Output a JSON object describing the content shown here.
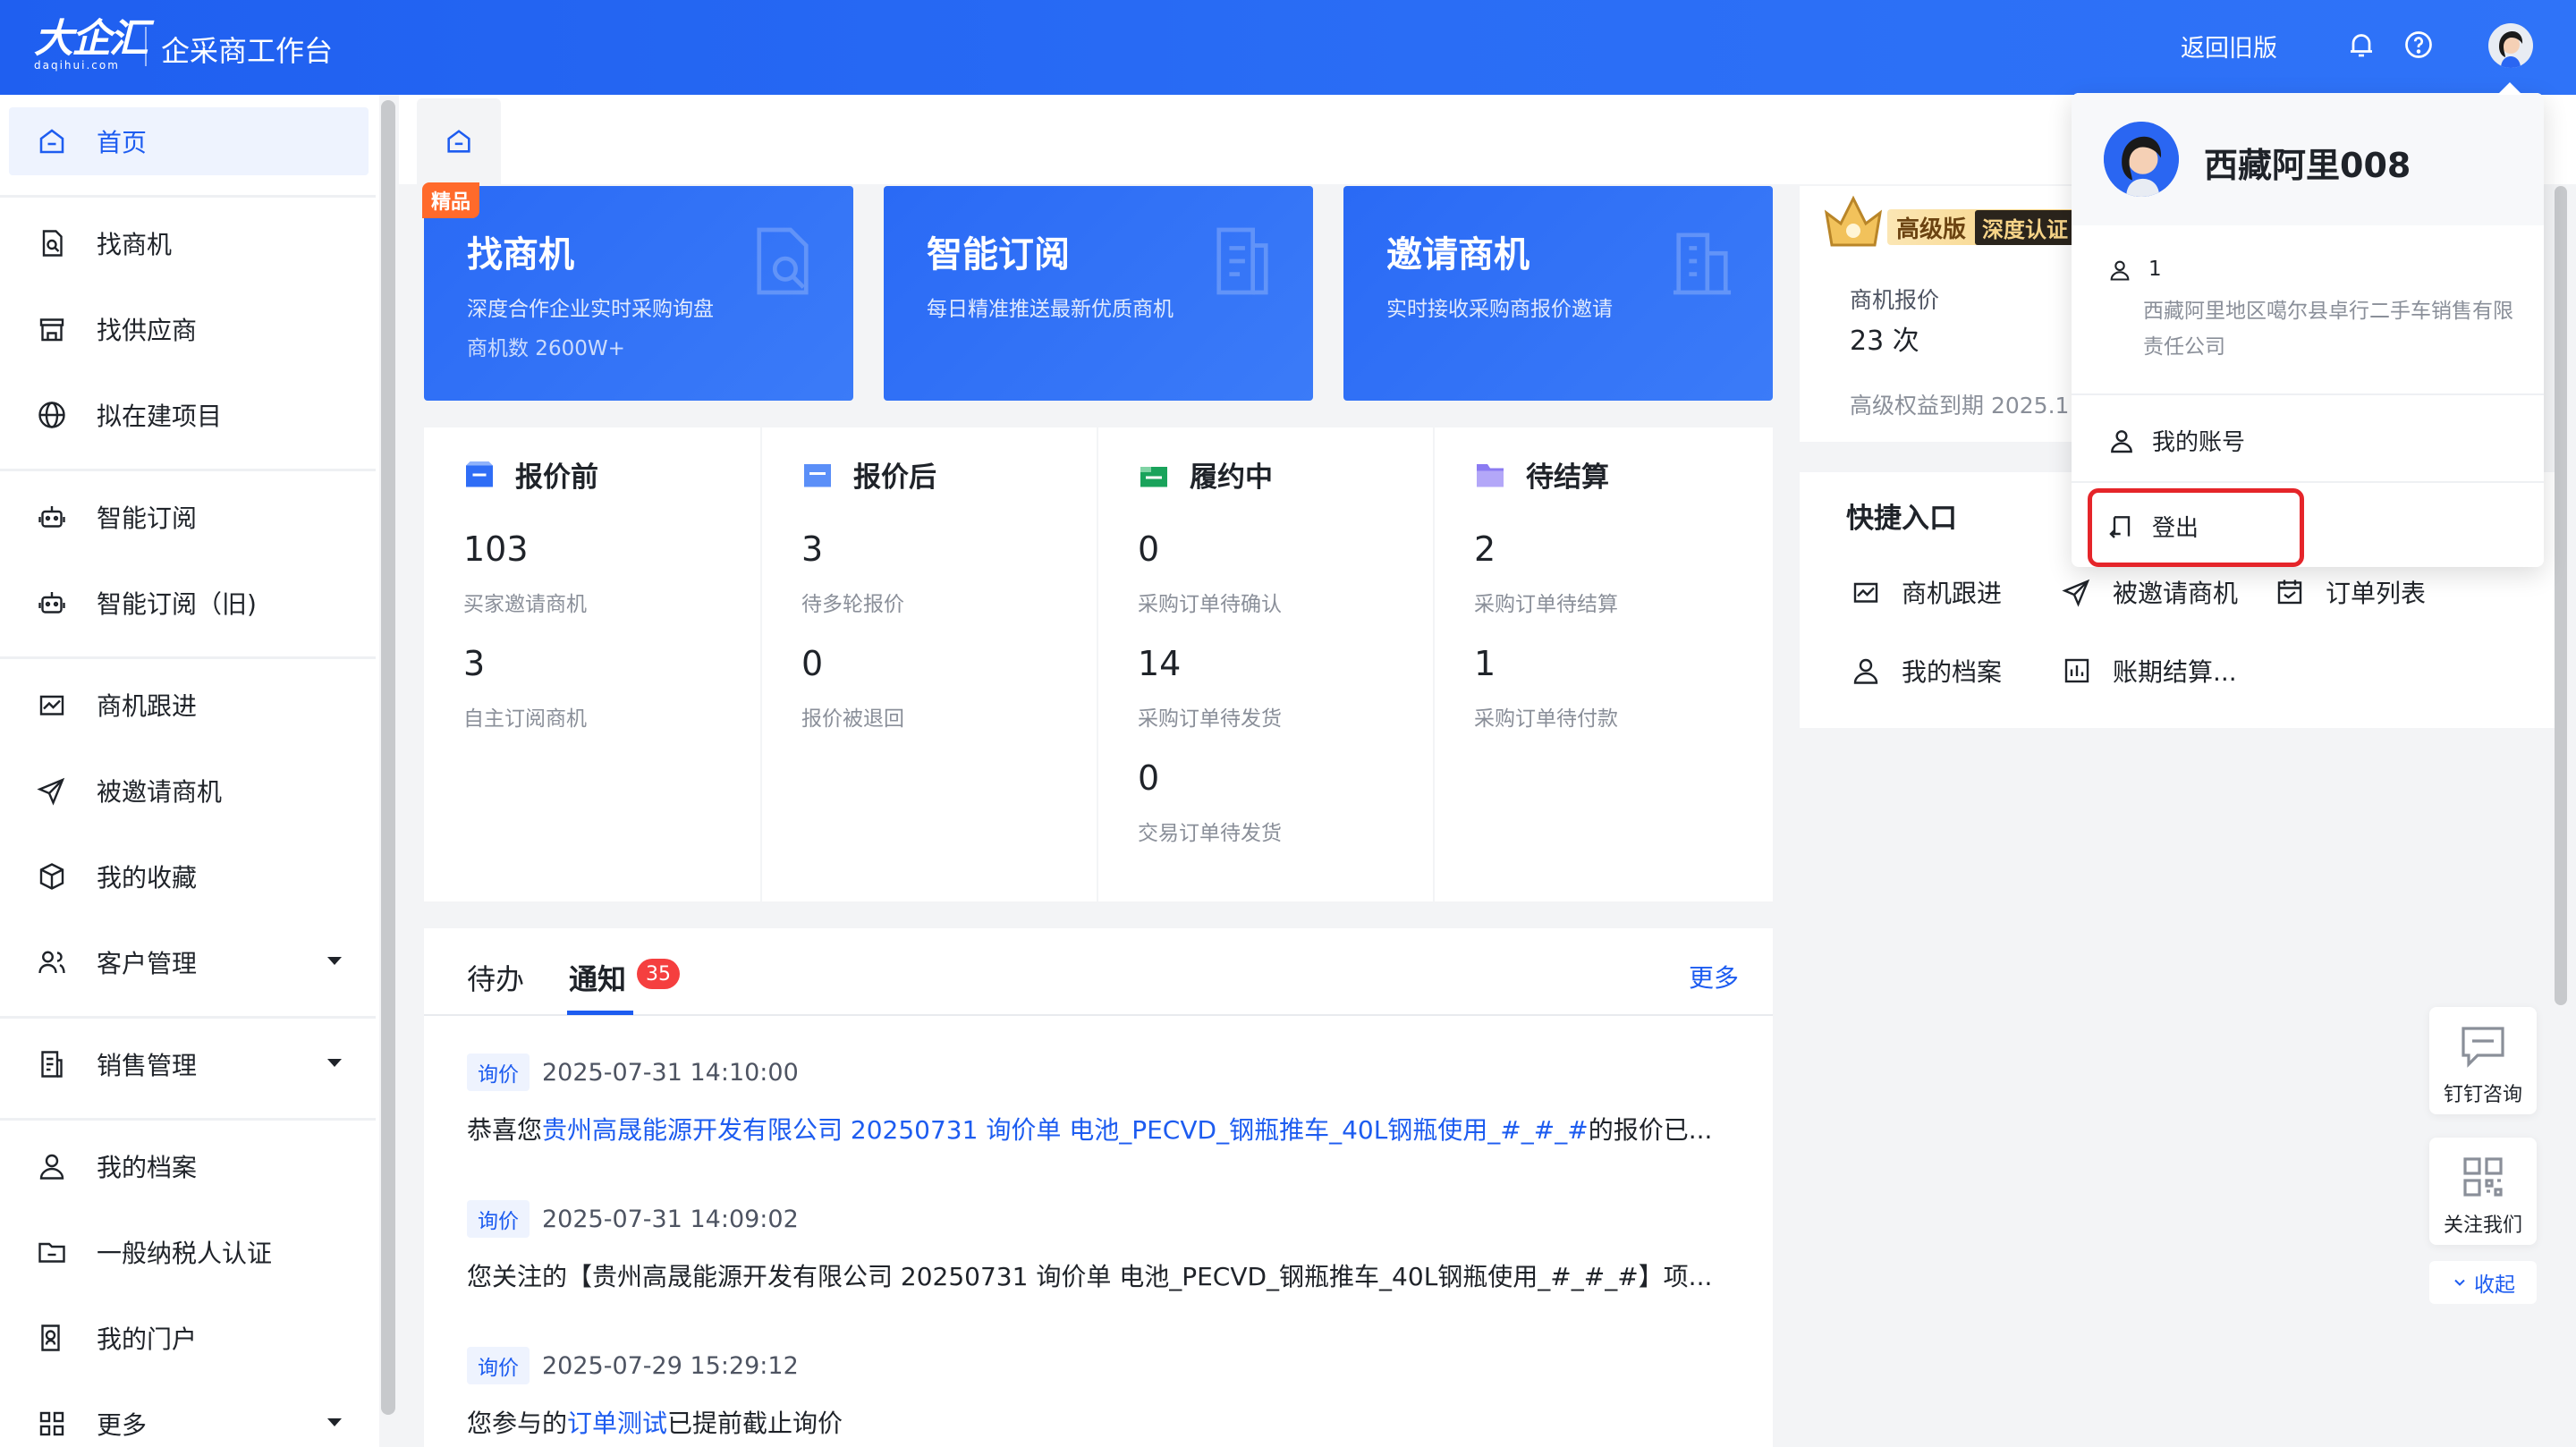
{
  "header": {
    "logo_main": "大企汇",
    "logo_sub": "daqihui.com",
    "app_title": "企采商工作台",
    "back_old": "返回旧版"
  },
  "sidebar": {
    "items": [
      {
        "label": "首页",
        "icon": "home-icon"
      },
      {
        "label": "找商机",
        "icon": "doc-search-icon"
      },
      {
        "label": "找供应商",
        "icon": "store-icon"
      },
      {
        "label": "拟在建项目",
        "icon": "globe-icon"
      },
      {
        "label": "智能订阅",
        "icon": "robot-icon"
      },
      {
        "label": "智能订阅（旧)",
        "icon": "robot-icon"
      },
      {
        "label": "商机跟进",
        "icon": "chart-icon"
      },
      {
        "label": "被邀请商机",
        "icon": "send-icon"
      },
      {
        "label": "我的收藏",
        "icon": "box-icon"
      },
      {
        "label": "客户管理",
        "icon": "users-icon"
      },
      {
        "label": "销售管理",
        "icon": "list-icon"
      },
      {
        "label": "我的档案",
        "icon": "user-icon"
      },
      {
        "label": "一般纳税人认证",
        "icon": "folder-icon"
      },
      {
        "label": "我的门户",
        "icon": "portal-icon"
      },
      {
        "label": "更多",
        "icon": "grid-icon"
      }
    ]
  },
  "features": [
    {
      "title": "找商机",
      "desc": "深度合作企业实时采购询盘",
      "count": "商机数 2600W+",
      "badge": "精品"
    },
    {
      "title": "智能订阅",
      "desc": "每日精准推送最新优质商机"
    },
    {
      "title": "邀请商机",
      "desc": "实时接收采购商报价邀请"
    }
  ],
  "stats": [
    {
      "title": "报价前",
      "entries": [
        {
          "num": "103",
          "label": "买家邀请商机"
        },
        {
          "num": "3",
          "label": "自主订阅商机"
        }
      ]
    },
    {
      "title": "报价后",
      "entries": [
        {
          "num": "3",
          "label": "待多轮报价"
        },
        {
          "num": "0",
          "label": "报价被退回"
        }
      ]
    },
    {
      "title": "履约中",
      "entries": [
        {
          "num": "0",
          "label": "采购订单待确认"
        },
        {
          "num": "14",
          "label": "采购订单待发货"
        },
        {
          "num": "0",
          "label": "交易订单待发货"
        }
      ]
    },
    {
      "title": "待结算",
      "entries": [
        {
          "num": "2",
          "label": "采购订单待结算"
        },
        {
          "num": "1",
          "label": "采购订单待付款"
        }
      ]
    }
  ],
  "notices": {
    "tab_todo": "待办",
    "tab_notice": "通知",
    "count": "35",
    "more": "更多",
    "items": [
      {
        "tag": "询价",
        "time": "2025-07-31 14:10:00",
        "pre": "恭喜您",
        "link": "贵州高晟能源开发有限公司 20250731 询价单 电池_PECVD_钢瓶推车_40L钢瓶使用_#_#_#",
        "post": "的报价已..."
      },
      {
        "tag": "询价",
        "time": "2025-07-31 14:09:02",
        "pre": "您关注的【贵州高晟能源开发有限公司 20250731 询价单 电池_PECVD_钢瓶推车_40L钢瓶使用_#_#_#】项...",
        "link": "",
        "post": ""
      },
      {
        "tag": "询价",
        "time": "2025-07-29 15:29:12",
        "pre": "您参与的",
        "link": "订单测试",
        "post": "已提前截止询价"
      }
    ]
  },
  "member": {
    "level": "高级版",
    "cert": "深度认证",
    "quote_label": "商机报价",
    "quote_value": "23 次",
    "expire": "高级权益到期 2025.1"
  },
  "quick": {
    "title": "快捷入口",
    "items": [
      {
        "label": "商机跟进",
        "icon": "chart-icon"
      },
      {
        "label": "被邀请商机",
        "icon": "send-icon"
      },
      {
        "label": "订单列表",
        "icon": "calendar-icon"
      },
      {
        "label": "我的档案",
        "icon": "user-icon"
      },
      {
        "label": "账期结算...",
        "icon": "bar-chart-icon"
      }
    ]
  },
  "dropdown": {
    "name": "西藏阿里008",
    "id": "1",
    "company": "西藏阿里地区噶尔县卓行二手车销售有限责任公司",
    "account": "我的账号",
    "logout": "登出"
  },
  "floats": {
    "consult": "钉钉咨询",
    "follow": "关注我们",
    "collapse": "收起"
  },
  "colors": {
    "primary": "#1d5cf0",
    "badge_red": "#f53f3f",
    "highlight_red": "#e5252a"
  }
}
